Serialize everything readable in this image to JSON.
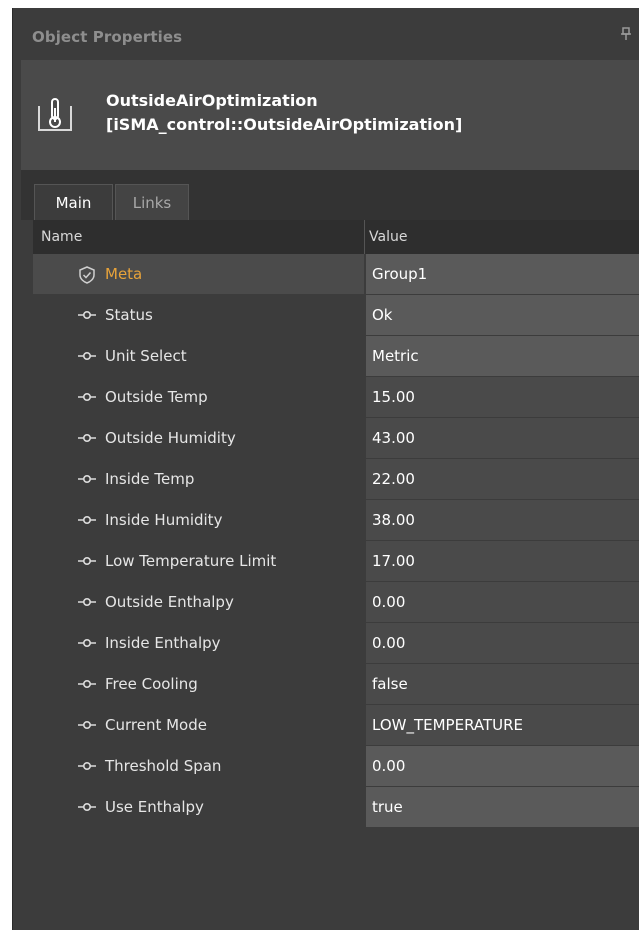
{
  "panel": {
    "title": "Object Properties",
    "pin_icon": "pin-icon"
  },
  "object": {
    "icon": "thermometer-icon",
    "name": "OutsideAirOptimization",
    "type": "[iSMA_control::OutsideAirOptimization]"
  },
  "tabs": [
    {
      "label": "Main",
      "active": true
    },
    {
      "label": "Links",
      "active": false
    }
  ],
  "grid": {
    "columns": {
      "name": "Name",
      "value": "Value"
    },
    "rows": [
      {
        "icon": "shield-check-icon",
        "name": "Meta",
        "value": "Group1"
      },
      {
        "icon": "slot-pin-icon",
        "name": "Status",
        "value": "Ok"
      },
      {
        "icon": "slot-pin-icon",
        "name": "Unit Select",
        "value": "Metric"
      },
      {
        "icon": "slot-pin-icon",
        "name": "Outside Temp",
        "value": "15.00"
      },
      {
        "icon": "slot-pin-icon",
        "name": "Outside Humidity",
        "value": "43.00"
      },
      {
        "icon": "slot-pin-icon",
        "name": "Inside Temp",
        "value": "22.00"
      },
      {
        "icon": "slot-pin-icon",
        "name": "Inside Humidity",
        "value": "38.00"
      },
      {
        "icon": "slot-pin-icon",
        "name": "Low Temperature Limit",
        "value": "17.00"
      },
      {
        "icon": "slot-pin-icon",
        "name": "Outside Enthalpy",
        "value": "0.00"
      },
      {
        "icon": "slot-pin-icon",
        "name": "Inside Enthalpy",
        "value": "0.00"
      },
      {
        "icon": "slot-pin-icon",
        "name": "Free Cooling",
        "value": "false"
      },
      {
        "icon": "slot-pin-icon",
        "name": "Current Mode",
        "value": "LOW_TEMPERATURE"
      },
      {
        "icon": "slot-pin-icon",
        "name": "Threshold Span",
        "value": "0.00"
      },
      {
        "icon": "slot-pin-icon",
        "name": "Use Enthalpy",
        "value": "true"
      }
    ]
  },
  "colors": {
    "meta_label": "#e8a33a",
    "panel_bg": "#3c3c3c",
    "header_bg": "#4a4a4a",
    "value_bg": "#5a5a5a"
  }
}
